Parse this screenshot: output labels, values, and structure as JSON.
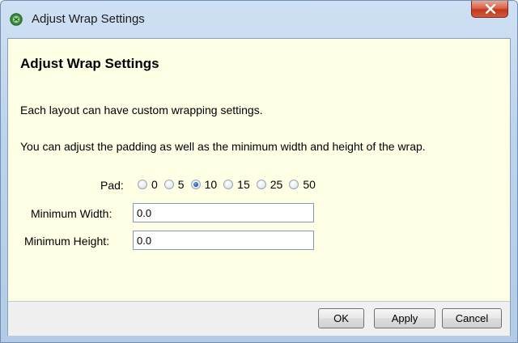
{
  "window": {
    "title": "Adjust Wrap Settings",
    "close_icon": "close-icon"
  },
  "content": {
    "heading": "Adjust Wrap Settings",
    "description_1": "Each layout can have custom wrapping settings.",
    "description_2": "You can adjust the padding as well as the minimum width and height of the wrap."
  },
  "pad": {
    "label": "Pad:",
    "options": [
      "0",
      "5",
      "10",
      "15",
      "25",
      "50"
    ],
    "selected": "10"
  },
  "fields": {
    "min_width_label": "Minimum Width:",
    "min_width_value": "0.0",
    "min_height_label": "Minimum Height:",
    "min_height_value": "0.0"
  },
  "buttons": {
    "ok": "OK",
    "apply": "Apply",
    "cancel": "Cancel"
  },
  "colors": {
    "client_background": "#ffffe6",
    "title_gradient_top": "#cfe0f3",
    "close_button": "#c1381b"
  }
}
